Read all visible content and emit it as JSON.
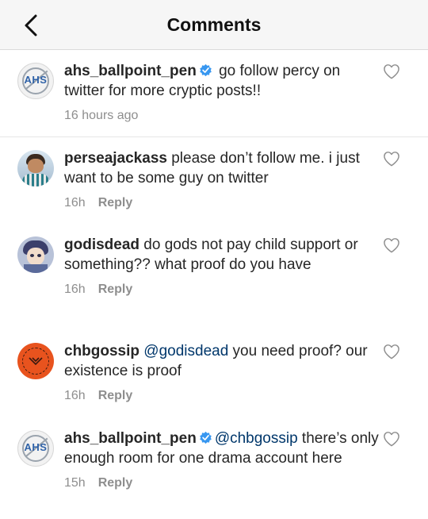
{
  "header": {
    "title": "Comments"
  },
  "comments": [
    {
      "username": "ahs_ballpoint_pen",
      "verified": true,
      "avatar": "ahs-logo",
      "avatar_text": "AHS",
      "text_pre": " go follow percy on twitter for more cryptic posts!!",
      "time": "16 hours ago",
      "reply": ""
    },
    {
      "username": "perseajackass",
      "verified": false,
      "avatar": "boy-photo",
      "text_pre": " please don’t follow me. i just want to be some guy on twitter",
      "time": "16h",
      "reply": "Reply"
    },
    {
      "username": "godisdead",
      "verified": false,
      "avatar": "anime-boy",
      "text_pre": " do gods not pay child support or something?? what proof do you have",
      "time": "16h",
      "reply": "Reply"
    },
    {
      "username": "chbgossip",
      "verified": false,
      "avatar": "chb-logo",
      "mention": "@godisdead",
      "text_post": " you need proof? our existence is proof",
      "time": "16h",
      "reply": "Reply"
    },
    {
      "username": "ahs_ballpoint_pen",
      "verified": true,
      "avatar": "ahs-logo",
      "avatar_text": "AHS",
      "mention": "@chbgossip",
      "text_post": " there’s only enough room for one drama account here",
      "time": "15h",
      "reply": "Reply"
    }
  ],
  "colors": {
    "verified": "#3897f0",
    "mention": "#00376b",
    "meta": "#8e8e8e",
    "text": "#262626"
  }
}
